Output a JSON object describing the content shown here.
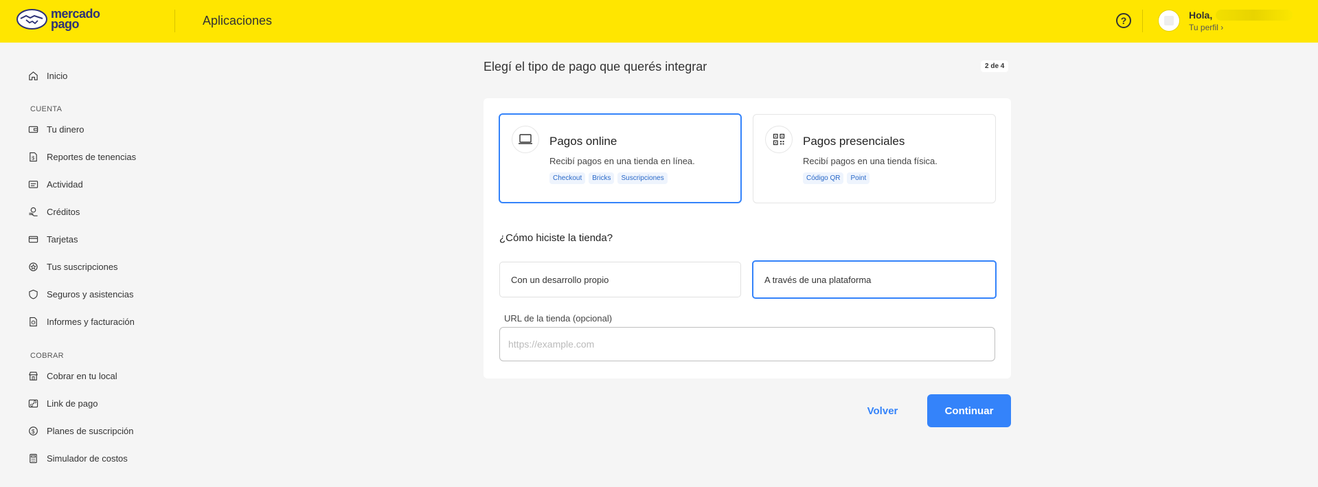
{
  "header": {
    "logo_text_line1": "mercado",
    "logo_text_line2": "pago",
    "app_title": "Aplicaciones",
    "help_icon": "question-circle-icon",
    "greeting": "Hola,",
    "profile_link": "Tu perfil ›"
  },
  "sidebar": {
    "home": {
      "label": "Inicio",
      "icon": "home-icon"
    },
    "sections": [
      {
        "title": "CUENTA",
        "items": [
          {
            "label": "Tu dinero",
            "icon": "wallet-icon"
          },
          {
            "label": "Reportes de tenencias",
            "icon": "report-icon"
          },
          {
            "label": "Actividad",
            "icon": "activity-icon"
          },
          {
            "label": "Créditos",
            "icon": "credits-icon"
          },
          {
            "label": "Tarjetas",
            "icon": "card-icon"
          },
          {
            "label": "Tus suscripciones",
            "icon": "subscriptions-icon"
          },
          {
            "label": "Seguros y asistencias",
            "icon": "shield-icon"
          },
          {
            "label": "Informes y facturación",
            "icon": "invoice-icon"
          }
        ]
      },
      {
        "title": "COBRAR",
        "items": [
          {
            "label": "Cobrar en tu local",
            "icon": "store-icon"
          },
          {
            "label": "Link de pago",
            "icon": "link-icon"
          },
          {
            "label": "Planes de suscripción",
            "icon": "dollar-circle-icon"
          },
          {
            "label": "Simulador de costos",
            "icon": "calculator-icon"
          }
        ]
      }
    ]
  },
  "main": {
    "title": "Elegí el tipo de pago que querés integrar",
    "step": "2 de 4",
    "cards": [
      {
        "title": "Pagos online",
        "description": "Recibí pagos en una tienda en línea.",
        "tags": [
          "Checkout",
          "Bricks",
          "Suscripciones"
        ],
        "icon": "laptop-icon",
        "selected": true
      },
      {
        "title": "Pagos presenciales",
        "description": "Recibí pagos en una tienda física.",
        "tags": [
          "Código QR",
          "Point"
        ],
        "icon": "qr-code-icon",
        "selected": false
      }
    ],
    "question": "¿Cómo hiciste la tienda?",
    "options": [
      {
        "label": "Con un desarrollo propio",
        "selected": false
      },
      {
        "label": "A través de una plataforma",
        "selected": true
      }
    ],
    "url_label": "URL de la tienda (opcional)",
    "url_placeholder": "https://example.com",
    "url_value": "",
    "back_label": "Volver",
    "continue_label": "Continuar"
  },
  "colors": {
    "header_bg": "#ffe600",
    "accent": "#3483fa",
    "page_bg": "#f5f5f5"
  }
}
